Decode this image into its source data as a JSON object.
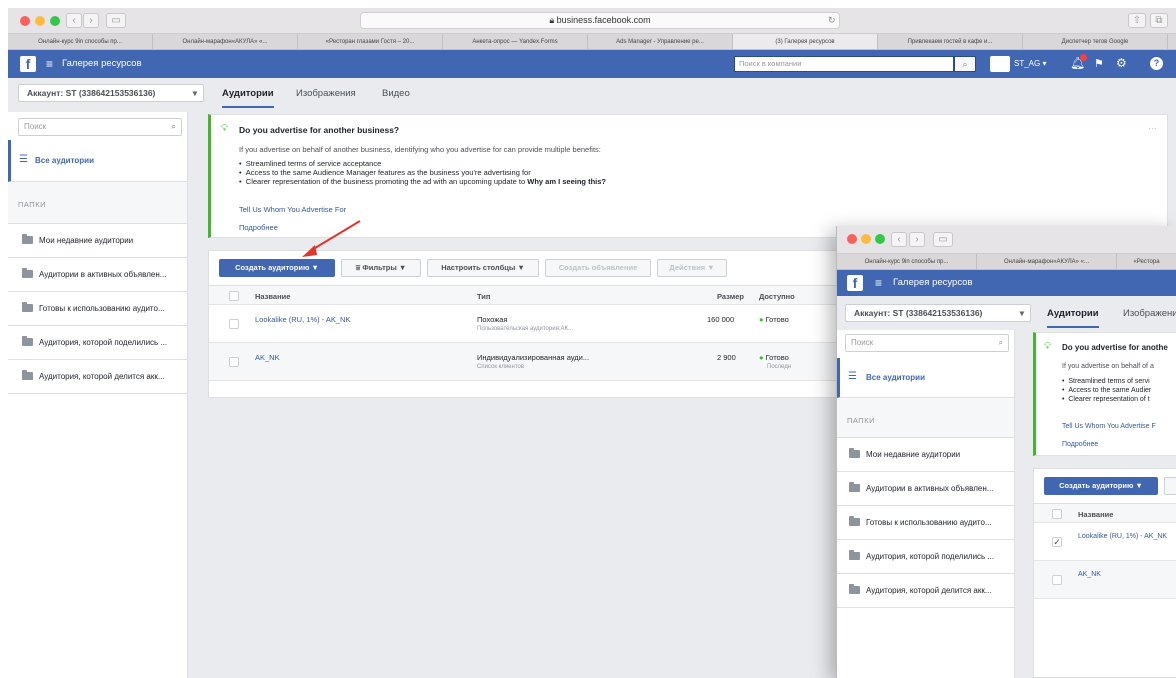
{
  "browser": {
    "url": "business.facebook.com",
    "tabs": [
      "Онлайн-курс 9in способы пр...",
      "Онлайн-марафон«АКУЛА» «...",
      "«Ресторан глазами Гостя – 20...",
      "Анкета-опрос — Yandex.Forms",
      "Ads Manager - Управление ре...",
      "(3) Галерея ресурсов",
      "Привлекаем гостей в кафе и...",
      "Диспетчер тегов Google"
    ],
    "tabs2": [
      "Онлайн-курс 9in способы пр...",
      "Онлайн-марафон«АКУЛА» «...",
      "«Рестора"
    ]
  },
  "header": {
    "title": "Галерея ресурсов",
    "search_placeholder": "Поиск в компании",
    "user": "ST_AG",
    "logo": "f"
  },
  "account": "Аккаунт: ST (338642153536136)",
  "page_tabs": [
    "Аудитории",
    "Изображения",
    "Видео"
  ],
  "page_tabs2": [
    "Аудитории",
    "Изображени"
  ],
  "sidebar": {
    "search_placeholder": "Поиск",
    "all_audiences": "Все аудитории",
    "folders_title": "ПАПКИ",
    "folders": [
      "Мои недавние аудитории",
      "Аудитории в активных объявлен...",
      "Готовы к использованию аудито...",
      "Аудитория, которой поделились ...",
      "Аудитория, которой делится акк..."
    ]
  },
  "info": {
    "title": "Do you advertise for another business?",
    "title2": "Do you advertise for anothe",
    "text": "If you advertise on behalf of another business, identifying who you advertise for can provide multiple benefits:",
    "text2": "If you advertise on behalf of a",
    "bullets": [
      "Streamlined terms of service acceptance",
      "Access to the same Audience Manager features as the business you're advertising for",
      "Clearer representation of the business promoting the ad with an upcoming update to"
    ],
    "bullets2": [
      "Streamlined terms of servi",
      "Access to the same Audier",
      "Clearer representation of t"
    ],
    "bullet_bold": "Why am I seeing this?",
    "link1": "Tell Us Whom You Advertise For",
    "link1_short": "Tell Us Whom You Advertise F",
    "link2": "Подробнее"
  },
  "toolbar": {
    "create": "Создать аудиторию ▼",
    "filters": "Фильтры ▼",
    "columns": "Настроить столбцы ▼",
    "create_ad": "Создать объявление",
    "actions": "Действия ▼"
  },
  "table": {
    "headers": [
      "Название",
      "Тип",
      "Размер",
      "Доступно"
    ],
    "rows": [
      {
        "name": "Lookalike (RU, 1%) - AK_NK",
        "type": "Похожая",
        "type_sub": "Пользовательская аудитория:АК...",
        "size": "160 000",
        "status": "Готово",
        "status_sub": ""
      },
      {
        "name": "AK_NK",
        "type": "Индивидуализированная ауди...",
        "type_sub": "Список клиентов",
        "size": "2 900",
        "status": "Готово",
        "status_sub": "Последн"
      }
    ]
  },
  "colors": {
    "brand": "#4267b2",
    "ok": "#42b72a",
    "arrow": "#e0362b"
  }
}
